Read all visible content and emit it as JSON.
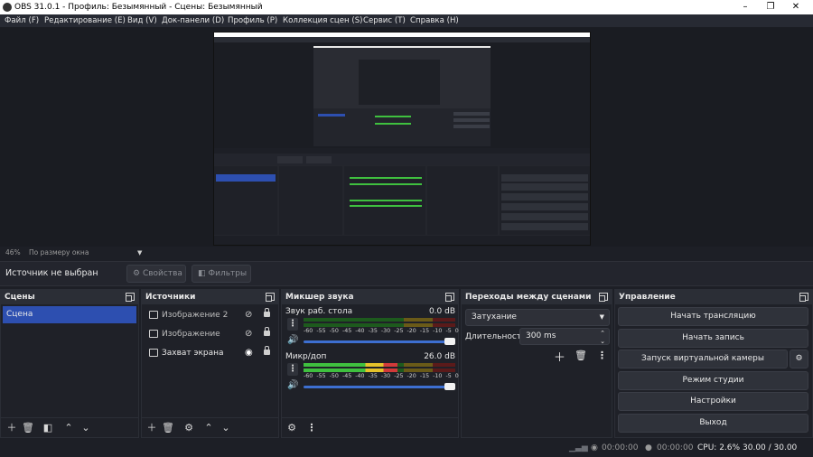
{
  "window": {
    "title": "OBS 31.0.1 - Профиль: Безымянный - Сцены: Безымянный"
  },
  "menu": [
    "Файл (F)",
    "Редактирование (E)",
    "Вид (V)",
    "Док-панели (D)",
    "Профиль (P)",
    "Коллекция сцен (S)",
    "Сервис (T)",
    "Справка (H)"
  ],
  "zoom": {
    "percent": "46%",
    "mode": "По размеру окна"
  },
  "context": {
    "no_source": "Источник не выбран",
    "properties": "Свойства",
    "filters": "Фильтры"
  },
  "scenes": {
    "title": "Сцены",
    "items": [
      "Сцена"
    ]
  },
  "sources": {
    "title": "Источники",
    "items": [
      {
        "label": "Изображение 2",
        "visible": false
      },
      {
        "label": "Изображение",
        "visible": false
      },
      {
        "label": "Захват экрана",
        "visible": true
      }
    ]
  },
  "mixer": {
    "title": "Микшер звука",
    "ticks": [
      "-60",
      "-55",
      "-50",
      "-45",
      "-40",
      "-35",
      "-30",
      "-25",
      "-20",
      "-15",
      "-10",
      "-5",
      "0"
    ],
    "channels": [
      {
        "name": "Звук раб. стола",
        "db": "0.0 dB",
        "level": 0.0
      },
      {
        "name": "Микр/доп",
        "db": "26.0 dB",
        "level": 0.6
      }
    ]
  },
  "transitions": {
    "title": "Переходы между сценами",
    "type": "Затухание",
    "duration_label": "Длительность",
    "duration_value": "300 ms"
  },
  "controls": {
    "title": "Управление",
    "start_stream": "Начать трансляцию",
    "start_record": "Начать запись",
    "virtual_cam": "Запуск виртуальной камеры",
    "studio_mode": "Режим студии",
    "settings": "Настройки",
    "exit": "Выход"
  },
  "status": {
    "stream_time": "00:00:00",
    "record_time": "00:00:00",
    "cpu": "CPU: 2.6%",
    "fps": "30.00 / 30.00 FPS"
  },
  "colors": {
    "accent": "#2d4fb0",
    "meter_green": "#3fc03f",
    "meter_yellow": "#e5c22a",
    "meter_red": "#d23a3a",
    "slider": "#3d6fd1"
  }
}
